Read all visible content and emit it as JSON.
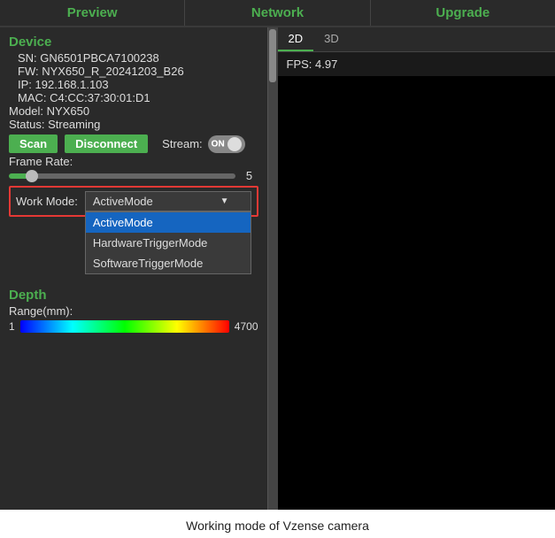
{
  "tabs": [
    {
      "label": "Preview",
      "id": "preview"
    },
    {
      "label": "Network",
      "id": "network"
    },
    {
      "label": "Upgrade",
      "id": "upgrade"
    }
  ],
  "device": {
    "section_title": "Device",
    "sn": "SN: GN6501PBCA7100238",
    "fw": "FW: NYX650_R_20241203_B26",
    "ip": "IP: 192.168.1.103",
    "mac": "MAC: C4:CC:37:30:01:D1",
    "model": "Model: NYX650",
    "status": "Status: Streaming"
  },
  "buttons": {
    "scan_label": "Scan",
    "disconnect_label": "Disconnect",
    "stream_label": "Stream:",
    "toggle_label": "ON"
  },
  "frame_rate": {
    "label": "Frame Rate:",
    "value": "5"
  },
  "work_mode": {
    "label": "Work Mode:",
    "selected": "ActiveMode",
    "options": [
      {
        "label": "ActiveMode",
        "selected": true
      },
      {
        "label": "HardwareTriggerMode",
        "selected": false
      },
      {
        "label": "SoftwareTriggerMode",
        "selected": false
      }
    ]
  },
  "depth": {
    "section_title": "Depth",
    "range_label": "Range(mm):",
    "range_min": "1",
    "range_max": "4700"
  },
  "view": {
    "tab_2d": "2D",
    "tab_3d": "3D",
    "fps_label": "FPS: 4.97"
  },
  "caption": "Working mode of Vzense camera"
}
